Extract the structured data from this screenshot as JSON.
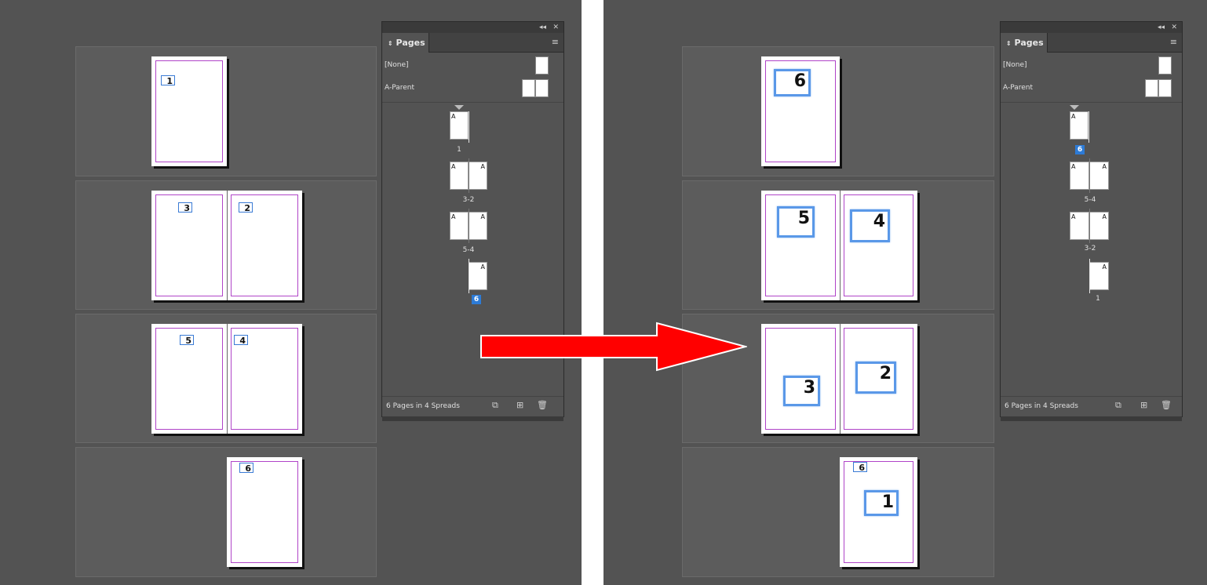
{
  "left": {
    "page_frames": [
      "1",
      "3",
      "2",
      "5",
      "4",
      "6"
    ],
    "panel": {
      "tab_label": "Pages",
      "parent_none": "[None]",
      "parent_a": "A-Parent",
      "thumbs": [
        {
          "label": "1",
          "prefix": "A"
        },
        {
          "label": "3-2",
          "prefix": "A"
        },
        {
          "label": "5-4",
          "prefix": "A"
        },
        {
          "label": "6",
          "prefix": "A"
        }
      ],
      "status": "6 Pages in 4 Spreads"
    }
  },
  "right": {
    "page_frames": [
      "6",
      "5",
      "4",
      "3",
      "2",
      "6",
      "1"
    ],
    "panel": {
      "tab_label": "Pages",
      "parent_none": "[None]",
      "parent_a": "A-Parent",
      "thumbs": [
        {
          "label": "6",
          "prefix": "A"
        },
        {
          "label": "5-4",
          "prefix": "A"
        },
        {
          "label": "3-2",
          "prefix": "A"
        },
        {
          "label": "1",
          "prefix": "A"
        }
      ],
      "status": "6 Pages in 4 Spreads"
    }
  },
  "icons": {
    "collapse": "collapse-icon",
    "close": "close-icon",
    "panel_menu": "panel-menu-icon",
    "edit_page_size": "edit-page-size-icon",
    "new_page": "new-page-icon",
    "delete_page": "trash-icon"
  },
  "colors": {
    "pasteboard": "#535353",
    "page_margin": "#b044c8",
    "frame_border": "#3a7bd5",
    "selected_page": "#2d7bd6",
    "arrow": "#ff0000"
  }
}
